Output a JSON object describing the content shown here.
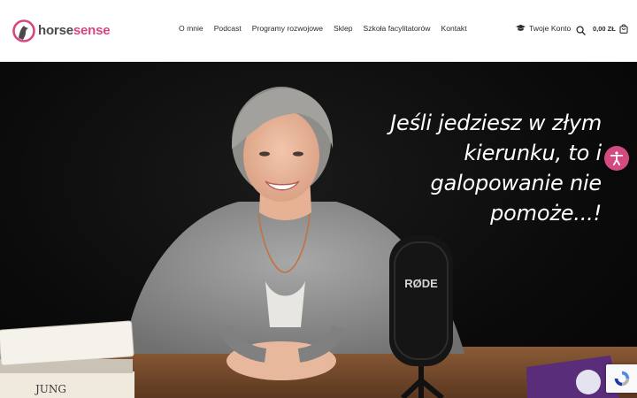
{
  "header": {
    "logo": {
      "part1": "horse",
      "part2": "sense"
    },
    "nav": [
      {
        "label": "O mnie"
      },
      {
        "label": "Podcast"
      },
      {
        "label": "Programy rozwojowe"
      },
      {
        "label": "Sklep"
      },
      {
        "label": "Szkoła facylitatorów"
      },
      {
        "label": "Kontakt"
      }
    ],
    "account_label": "Twoje Konto",
    "cart_total": "0,00 ZŁ"
  },
  "hero": {
    "quote": "Jeśli jedziesz w złym kierunku, to i galopowanie nie pomoże...!",
    "microphone_brand": "RØDE",
    "book_spine": "JUNG"
  },
  "colors": {
    "accent": "#d9457f",
    "text": "#2b2b2b"
  }
}
